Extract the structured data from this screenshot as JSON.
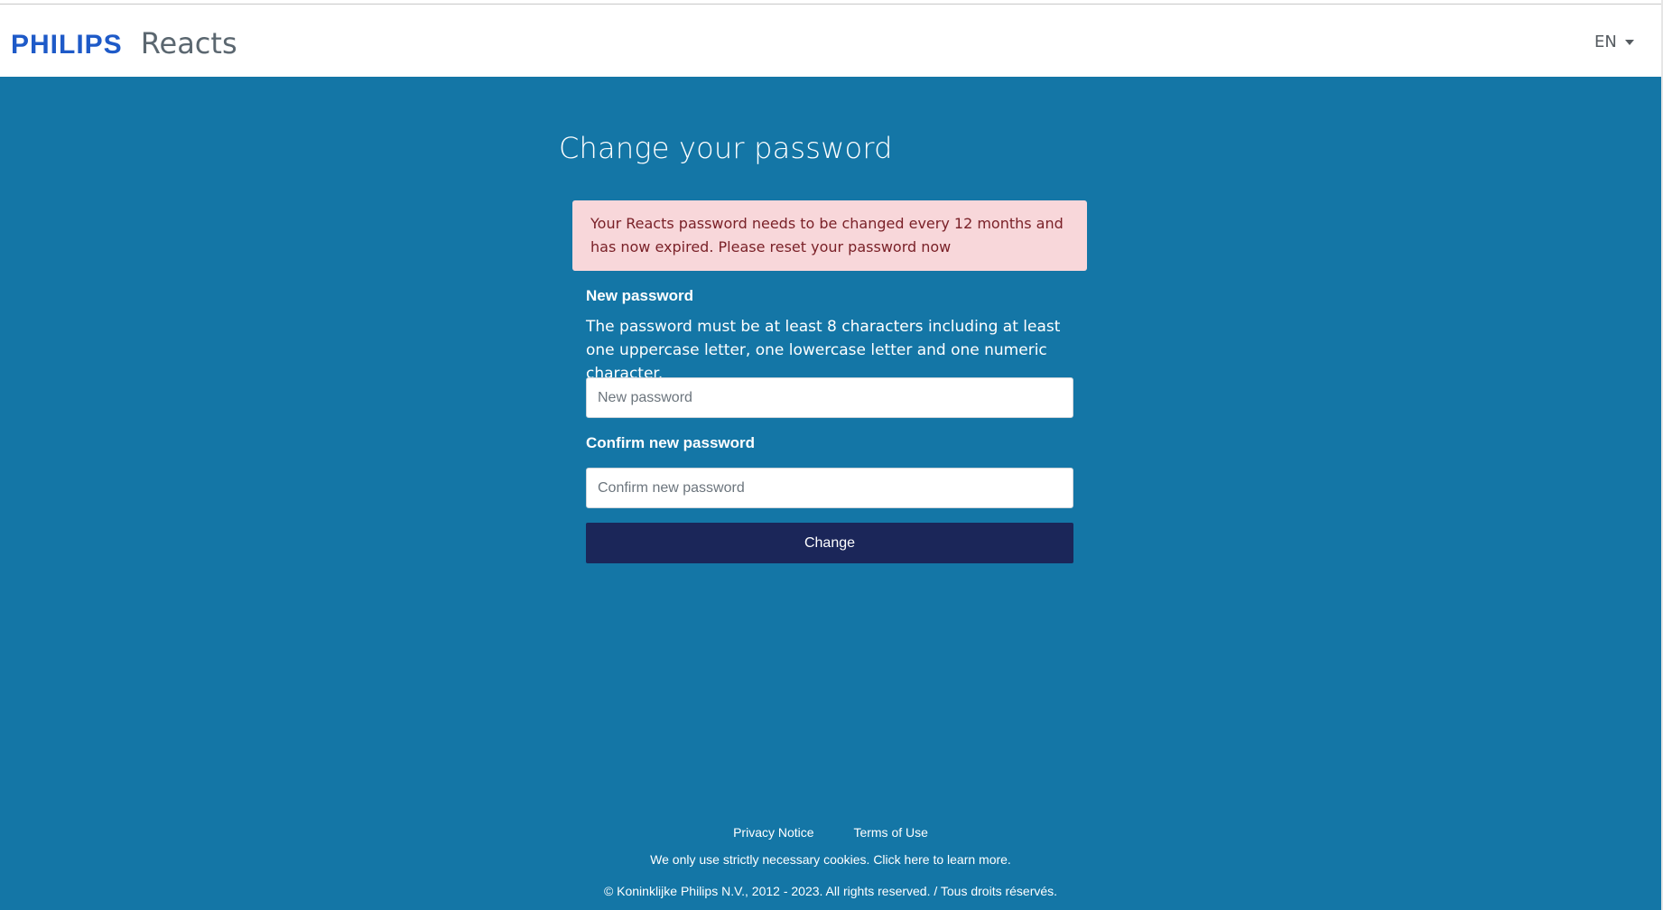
{
  "header": {
    "logo_text": "PHILIPS",
    "app_name": "Reacts",
    "language": "EN"
  },
  "main": {
    "title": "Change your password",
    "alert": "Your Reacts password needs to be changed every 12 months and has now expired. Please reset your password now",
    "new_password": {
      "label": "New password",
      "help": "The password must be at least 8 characters including at least one uppercase letter, one lowercase letter and one numeric character.",
      "placeholder": "New password",
      "value": ""
    },
    "confirm_password": {
      "label": "Confirm new password",
      "placeholder": "Confirm new password",
      "value": ""
    },
    "submit_label": "Change"
  },
  "footer": {
    "links": [
      "Privacy Notice",
      "Terms of Use"
    ],
    "cookie_notice": "We only use strictly necessary cookies. Click here to learn more.",
    "copyright": "© Koninklijke Philips N.V., 2012 - 2023. All rights reserved. / Tous droits réservés."
  },
  "colors": {
    "brand_blue": "#1e5ac8",
    "page_background": "#1476a6",
    "button": "#1b2659",
    "alert_background": "#f8d7da",
    "alert_text": "#7a2128"
  },
  "icons": {
    "language_caret": "caret-down-icon"
  }
}
